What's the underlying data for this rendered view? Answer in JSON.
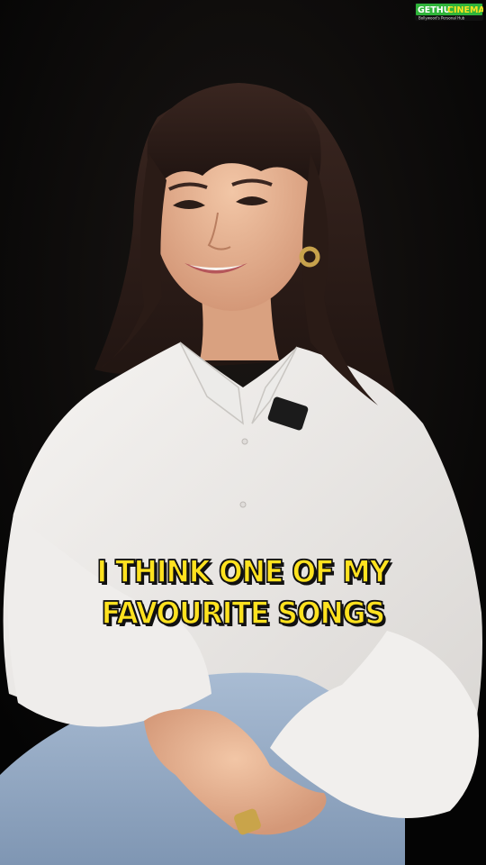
{
  "logo": {
    "brand_part1": "GETHU",
    "brand_part2": "CINEMA",
    "tagline": "Bollywood's Personal Hub"
  },
  "caption": {
    "line1": "I THINK ONE OF MY",
    "line2": "FAVOURITE SONGS"
  }
}
